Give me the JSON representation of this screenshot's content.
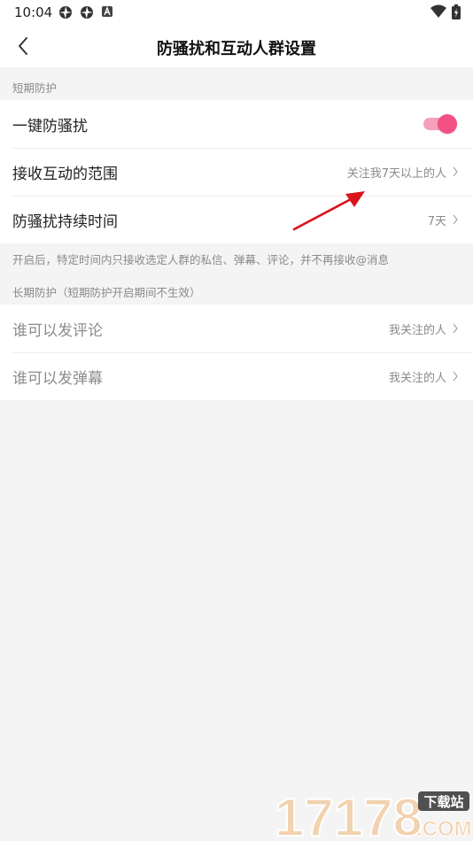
{
  "status_bar": {
    "time": "10:04"
  },
  "header": {
    "title": "防骚扰和互动人群设置"
  },
  "short_term": {
    "section_label": "短期防护",
    "one_key": {
      "label": "一键防骚扰",
      "enabled": true
    },
    "range": {
      "label": "接收互动的范围",
      "value": "关注我7天以上的人"
    },
    "duration": {
      "label": "防骚扰持续时间",
      "value": "7天"
    },
    "hint": "开启后，特定时间内只接收选定人群的私信、弹幕、评论，并不再接收@消息"
  },
  "long_term": {
    "section_label": "长期防护（短期防护开启期间不生效）",
    "comment": {
      "label": "谁可以发评论",
      "value": "我关注的人"
    },
    "danmaku": {
      "label": "谁可以发弹幕",
      "value": "我关注的人"
    }
  },
  "watermark": {
    "logo_text": "17178",
    "badge": "下载站",
    "suffix": ".COM"
  },
  "colors": {
    "accent": "#f24f82",
    "annotation": "#d9141b"
  }
}
